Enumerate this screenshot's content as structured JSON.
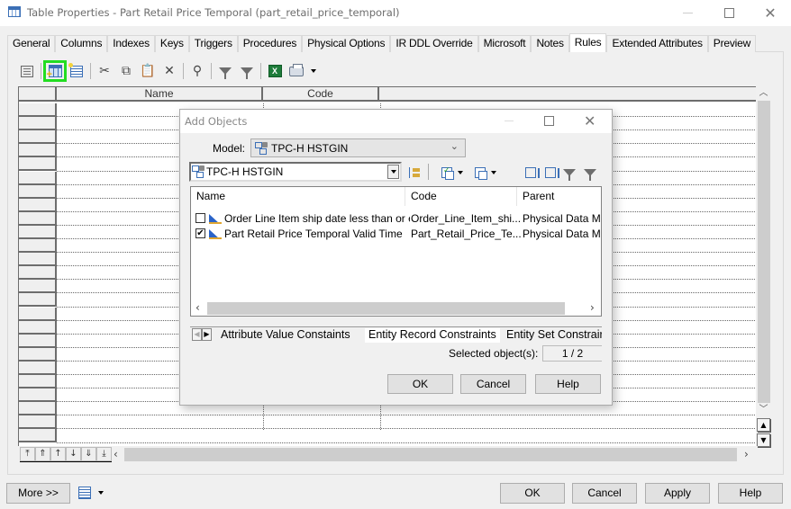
{
  "window": {
    "title": "Table Properties - Part Retail Price Temporal (part_retail_price_temporal)",
    "icon": "table-icon",
    "controls": [
      "minimize",
      "maximize",
      "close"
    ]
  },
  "tabs": [
    {
      "label": "General"
    },
    {
      "label": "Columns"
    },
    {
      "label": "Indexes"
    },
    {
      "label": "Keys"
    },
    {
      "label": "Triggers"
    },
    {
      "label": "Procedures"
    },
    {
      "label": "Physical Options"
    },
    {
      "label": "IR DDL Override"
    },
    {
      "label": "Microsoft"
    },
    {
      "label": "Notes"
    },
    {
      "label": "Rules",
      "active": true
    },
    {
      "label": "Extended Attributes"
    },
    {
      "label": "Preview"
    }
  ],
  "toolbar": {
    "items": [
      "properties-icon",
      "add-objects-icon",
      "add-row-icon",
      "cut-icon",
      "copy-icon",
      "paste-icon",
      "delete-icon",
      "find-icon",
      "customize-filter-icon",
      "enable-filter-icon",
      "export-excel-icon",
      "print-icon"
    ],
    "highlighted": "add-objects-icon",
    "highlight_color": "#22dd22"
  },
  "grid": {
    "columns": [
      "Name",
      "Code"
    ],
    "rows": []
  },
  "grid_nav": [
    "move-to-top",
    "move-page-up",
    "move-up",
    "move-down",
    "move-page-down",
    "move-to-bottom"
  ],
  "bottom": {
    "more": "More >>",
    "ok": "OK",
    "cancel": "Cancel",
    "apply": "Apply",
    "help": "Help"
  },
  "dialog": {
    "title": "Add Objects",
    "model_label": "Model:",
    "model_value": "TPC-H HSTGIN",
    "package_value": "TPC-H HSTGIN",
    "columns": [
      "Name",
      "Code",
      "Parent"
    ],
    "rows": [
      {
        "checked": false,
        "name": "Order Line Item ship date less than or eq...",
        "code": "Order_Line_Item_shi...",
        "parent": "Physical Data Mod"
      },
      {
        "checked": true,
        "name": "Part Retail Price Temporal Valid Time",
        "code": "Part_Retail_Price_Te...",
        "parent": "Physical Data Mod"
      }
    ],
    "category_tabs": [
      {
        "label": "Attribute Value Constaints"
      },
      {
        "label": "Entity Record Constraints",
        "active": true
      },
      {
        "label": "Entity Set Constrair"
      }
    ],
    "selected_label": "Selected object(s):",
    "selected_value": "1 / 2",
    "ok": "OK",
    "cancel": "Cancel",
    "help": "Help"
  }
}
